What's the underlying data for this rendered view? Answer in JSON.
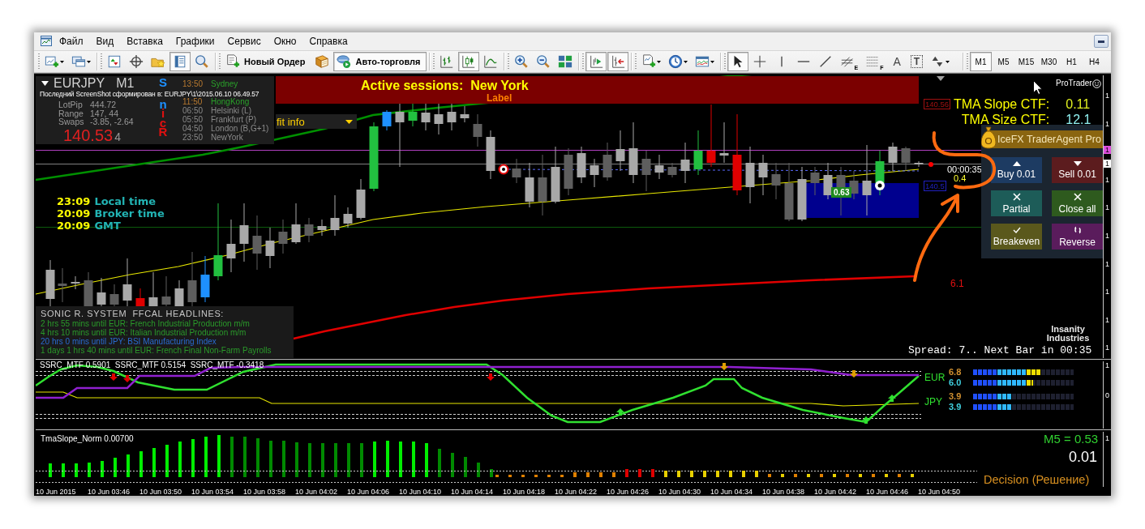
{
  "menu": {
    "items": [
      "Файл",
      "Вид",
      "Вставка",
      "Графики",
      "Сервис",
      "Окно",
      "Справка"
    ]
  },
  "toolbar": {
    "groups": [
      [
        {
          "kind": "newchart",
          "pressed": false
        },
        {
          "kind": "profiles",
          "pressed": false
        }
      ],
      [
        {
          "kind": "marketwatch",
          "pressed": false
        },
        {
          "kind": "datawindow",
          "pressed": false
        },
        {
          "kind": "navigator",
          "pressed": false
        },
        {
          "kind": "terminal",
          "pressed": true
        },
        {
          "kind": "tester",
          "pressed": false
        }
      ],
      [
        {
          "kind": "order",
          "label": "Новый Ордер",
          "pressed": false
        },
        {
          "kind": "editor",
          "pressed": false
        },
        {
          "kind": "autotrade",
          "label": "Авто-торговля",
          "pressed": true
        }
      ],
      [
        {
          "kind": "bars",
          "pressed": false
        },
        {
          "kind": "candles",
          "pressed": true
        },
        {
          "kind": "line",
          "pressed": false
        }
      ],
      [
        {
          "kind": "zoomin",
          "pressed": false
        },
        {
          "kind": "zoomout",
          "pressed": false
        },
        {
          "kind": "tile",
          "pressed": false
        }
      ],
      [
        {
          "kind": "autoscroll",
          "pressed": true
        },
        {
          "kind": "shift",
          "pressed": true
        }
      ],
      [
        {
          "kind": "indicators",
          "pressed": false
        },
        {
          "kind": "periods",
          "pressed": false
        },
        {
          "kind": "templates",
          "pressed": false
        }
      ],
      [
        {
          "kind": "cursor",
          "pressed": true
        },
        {
          "kind": "crosshair",
          "pressed": false
        },
        {
          "kind": "vline",
          "pressed": false
        },
        {
          "kind": "hline",
          "pressed": false
        },
        {
          "kind": "trendline",
          "pressed": false
        },
        {
          "kind": "fibochannel",
          "label": "E",
          "pressed": false
        },
        {
          "kind": "fibo",
          "label": "F",
          "pressed": false
        },
        {
          "kind": "text",
          "label": "A",
          "pressed": false
        },
        {
          "kind": "textlabel",
          "label": "T",
          "pressed": false
        },
        {
          "kind": "arrows",
          "pressed": false
        }
      ]
    ],
    "periods": [
      {
        "label": "M1",
        "selected": true
      },
      {
        "label": "M5",
        "selected": false
      },
      {
        "label": "M15",
        "selected": false
      },
      {
        "label": "M30",
        "selected": false
      },
      {
        "label": "H1",
        "selected": false
      },
      {
        "label": "H4",
        "selected": false
      }
    ]
  },
  "main_chart": {
    "symbol_panel": {
      "symbol": "EURJPY",
      "timeframe": "M1",
      "screenshot_note": "Последний ScreenShot сформирован в: EURJPY\\1\\2015.06.10 06.49.57",
      "stats": [
        {
          "label": "LotPip",
          "value": "444.72"
        },
        {
          "label": "Range",
          "value": "147, 44"
        },
        {
          "label": "Swaps",
          "value": "-3.85, -2.64"
        }
      ],
      "price": "140.53",
      "price_last_digit": "4",
      "letters": [
        {
          "text": "S",
          "color": "#1e90ff"
        },
        {
          "text": "n",
          "color": "#1e90ff"
        },
        {
          "text": "i",
          "color": "#e01010"
        },
        {
          "text": "c",
          "color": "#e01010"
        },
        {
          "text": "R",
          "color": "#e01010"
        }
      ],
      "sessions": [
        {
          "time": "13:50",
          "city": "Sydney",
          "open": true
        },
        {
          "time": "11:50",
          "city": "HongKong",
          "open": true
        },
        {
          "time": "06:50",
          "city": "Helsinki (L)",
          "open": false
        },
        {
          "time": "05:50",
          "city": "Frankfurt (P)",
          "open": false
        },
        {
          "time": "04:50",
          "city": "London (B,G+1)",
          "open": false
        },
        {
          "time": "23:50",
          "city": "NewYork",
          "open": false
        }
      ]
    },
    "banner": {
      "title": "Active sessions:  New York",
      "label": "Label"
    },
    "dropdown": {
      "value": "fit info"
    },
    "clocks": [
      {
        "time": "23:09",
        "label": "Local time"
      },
      {
        "time": "20:09",
        "label": "Broker time"
      },
      {
        "time": "20:09",
        "label": "GMT"
      }
    ],
    "brand": "ProTrader",
    "tma": [
      {
        "label": "TMA Slope CTF:",
        "value": "0.11",
        "color": "#e0f020"
      },
      {
        "label": "TMA Size CTF:",
        "value": "12.1",
        "color": "#90f0f0"
      }
    ],
    "price_labels": [
      {
        "text": "140.56",
        "color": "#a01010"
      },
      {
        "text": "140.5",
        "color": "#2020c0"
      }
    ],
    "countdown": "00:00:35",
    "countdown_value": "0.4",
    "position_badge": "0.63",
    "trade_panel": {
      "title": "IceFX TraderAgent Pro",
      "buttons": [
        {
          "kind": "buy",
          "label": "Buy 0.01"
        },
        {
          "kind": "sell",
          "label": "Sell 0.01"
        },
        {
          "kind": "partial",
          "label": "Partial"
        },
        {
          "kind": "closeall",
          "label": "Close all"
        },
        {
          "kind": "breakeven",
          "label": "Breakeven"
        },
        {
          "kind": "reverse",
          "label": "Reverse"
        }
      ]
    },
    "distance_value": "6.1",
    "logo": "Insanity Industries",
    "status_line": "Spread: 7.. Next Bar in 00:35",
    "headlines": {
      "title": "SONIC R. SYSTEM  FFCAL HEADLINES:",
      "items": [
        {
          "text": "2 hrs 55 mins until EUR: French Industrial Production m/m",
          "color": "#2a9a2a"
        },
        {
          "text": "4 hrs 10 mins until EUR: Italian Industrial Production m/m",
          "color": "#2a9a2a"
        },
        {
          "text": "20 hrs 0 mins until JPY: BSI Manufacturing Index",
          "color": "#2a6ad0"
        },
        {
          "text": "1 days 1 hrs 40 mins until EUR: French Final Non-Farm Payrolls",
          "color": "#2a9a2a"
        }
      ]
    },
    "price_scale": [
      "1",
      "1",
      "1",
      "1",
      "1",
      "1",
      "1",
      "1",
      "1"
    ],
    "price_markers": [
      {
        "text": "1",
        "color": "#e050e0"
      },
      {
        "text": "1",
        "color": "#ffffff"
      }
    ]
  },
  "ssrc_pane": {
    "title": "SSRC_MTF 0.5901  SSRC_MTF 0.5154  SSRC_MTF -0.3418",
    "currencies": [
      {
        "name": "EUR",
        "readings": [
          {
            "text": "6.8",
            "color": "#d09030",
            "level": 0.68
          },
          {
            "text": "6.0",
            "color": "#40d0e0",
            "level": 0.6
          }
        ]
      },
      {
        "name": "JPY",
        "readings": [
          {
            "text": "3.9",
            "color": "#d09030",
            "level": 0.39
          },
          {
            "text": "3.9",
            "color": "#40d0e0",
            "level": 0.39
          }
        ]
      }
    ],
    "scale": [
      "1",
      "0"
    ]
  },
  "tma_pane": {
    "title": "TmaSlope_Norm 0.00700",
    "m5_reading": "M5 = 0.53",
    "value": "0.01",
    "decision": "Decision (Решение)",
    "scale": [
      "1"
    ]
  },
  "time_axis": [
    "10 Jun 2015",
    "10 Jun 03:46",
    "10 Jun 03:50",
    "10 Jun 03:54",
    "10 Jun 03:58",
    "10 Jun 04:02",
    "10 Jun 04:06",
    "10 Jun 04:10",
    "10 Jun 04:14",
    "10 Jun 04:18",
    "10 Jun 04:22",
    "10 Jun 04:26",
    "10 Jun 04:30",
    "10 Jun 04:34",
    "10 Jun 04:38",
    "10 Jun 04:42",
    "10 Jun 04:46",
    "10 Jun 04:50"
  ]
}
